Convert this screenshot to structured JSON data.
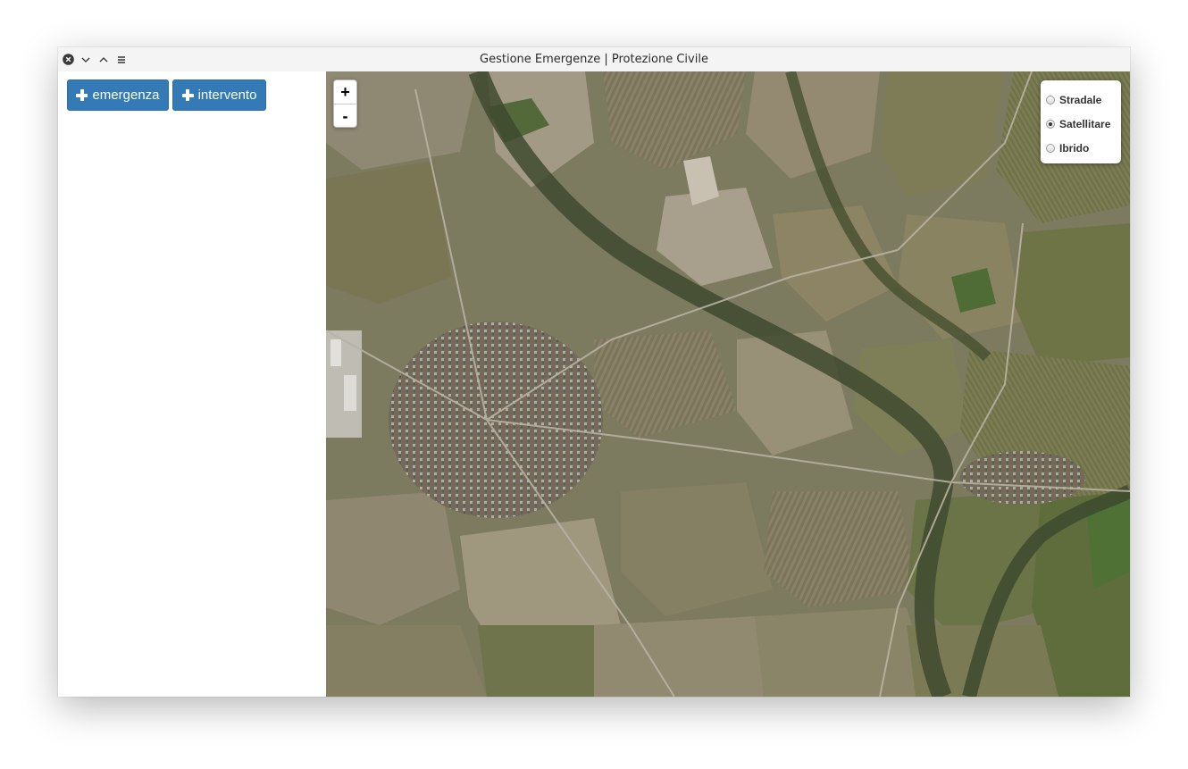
{
  "window": {
    "title": "Gestione Emergenze | Protezione Civile",
    "controls": [
      "close-icon",
      "minimize-icon",
      "maximize-icon",
      "menu-icon"
    ]
  },
  "sidebar": {
    "buttons": {
      "emergenza_label": "emergenza",
      "intervento_label": "intervento"
    },
    "accent": "#337ab7"
  },
  "map": {
    "view": "satellite",
    "zoom_in_label": "+",
    "zoom_out_label": "-",
    "layers": [
      {
        "label": "Stradale",
        "selected": false
      },
      {
        "label": "Satellitare",
        "selected": true
      },
      {
        "label": "Ibrido",
        "selected": false
      }
    ]
  }
}
